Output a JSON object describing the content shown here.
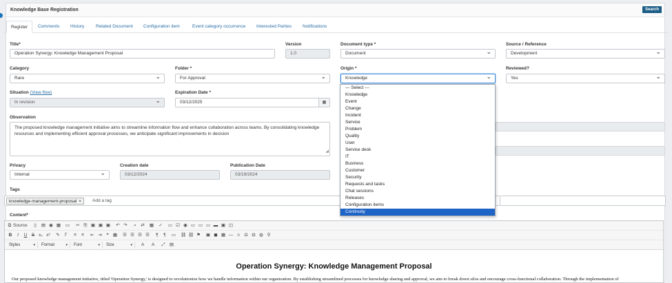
{
  "header": {
    "title": "Knowledge Base Registration",
    "search_label": "Search"
  },
  "tabs": [
    {
      "label": "Register"
    },
    {
      "label": "Comments"
    },
    {
      "label": "History"
    },
    {
      "label": "Related Document"
    },
    {
      "label": "Configuration item"
    },
    {
      "label": "Event category occurrence"
    },
    {
      "label": "Interested Parties"
    },
    {
      "label": "Notifications"
    }
  ],
  "form": {
    "title_label": "Title*",
    "title_value": "Operation Synergy: Knowledge Management Proposal",
    "version_label": "Version",
    "version_value": "1.0",
    "doctype_label": "Document type *",
    "doctype_value": "Document",
    "source_label": "Source / Reference",
    "source_value": "Development",
    "category_label": "Category",
    "category_value": "Rare",
    "folder_label": "Folder *",
    "folder_value": "For Approval",
    "origin_label": "Origin *",
    "origin_value": "Knowledge",
    "reviewed_label": "Reviewed?",
    "reviewed_value": "Yes",
    "situation_label": "Situation",
    "situation_link": "(View flow)",
    "situation_value": "In revision",
    "expiration_label": "Expiration Date *",
    "expiration_value": "03/12/2025",
    "observation_label": "Observation",
    "observation_value": "The proposed knowledge management initiative aims to streamline information flow and enhance collaboration across teams. By consolidating knowledge resources and implementing efficient approval processes, we anticipate significant improvements in decision",
    "privacy_label": "Privacy",
    "privacy_value": "Internal",
    "creation_label": "Creation date",
    "creation_value": "03/12/2024",
    "publication_label": "Publication Date",
    "publication_value": "03/19/2024",
    "tags_label": "Tags",
    "tag_chip": "knowledge-management-proposal",
    "tag_remove": "×",
    "tags_placeholder": "Add a tag",
    "content_label": "Content*"
  },
  "origin_options": [
    {
      "label": "--- Select ---"
    },
    {
      "label": "Knowledge"
    },
    {
      "label": "Event"
    },
    {
      "label": "Change"
    },
    {
      "label": "Incident"
    },
    {
      "label": "Service"
    },
    {
      "label": "Problem"
    },
    {
      "label": "Quality"
    },
    {
      "label": "User"
    },
    {
      "label": "Service desk"
    },
    {
      "label": "IT"
    },
    {
      "label": "Business"
    },
    {
      "label": "Customer"
    },
    {
      "label": "Security"
    },
    {
      "label": "Requests and tasks"
    },
    {
      "label": "Chat sessions"
    },
    {
      "label": "Releases"
    },
    {
      "label": "Configuration items"
    },
    {
      "label": "Continuity"
    }
  ],
  "origin_selected": "Continuity",
  "editor": {
    "source_label": "Source",
    "styles_label": "Styles",
    "format_label": "Format",
    "font_label": "Font",
    "size_label": "Size",
    "doc_title": "Operation Synergy: Knowledge Management Proposal",
    "doc_body": "Our proposed knowledge management initiative, titled 'Operation Synergy,' is designed to revolutionize how we handle information within our organization. By establishing streamlined processes for knowledge sharing and approval, we aim to break down silos and encourage cross-functional collaboration. Through the implementation of"
  },
  "colors": {
    "accent": "#1c5d86",
    "link": "#2a6ea6",
    "selected": "#1e63c6"
  }
}
